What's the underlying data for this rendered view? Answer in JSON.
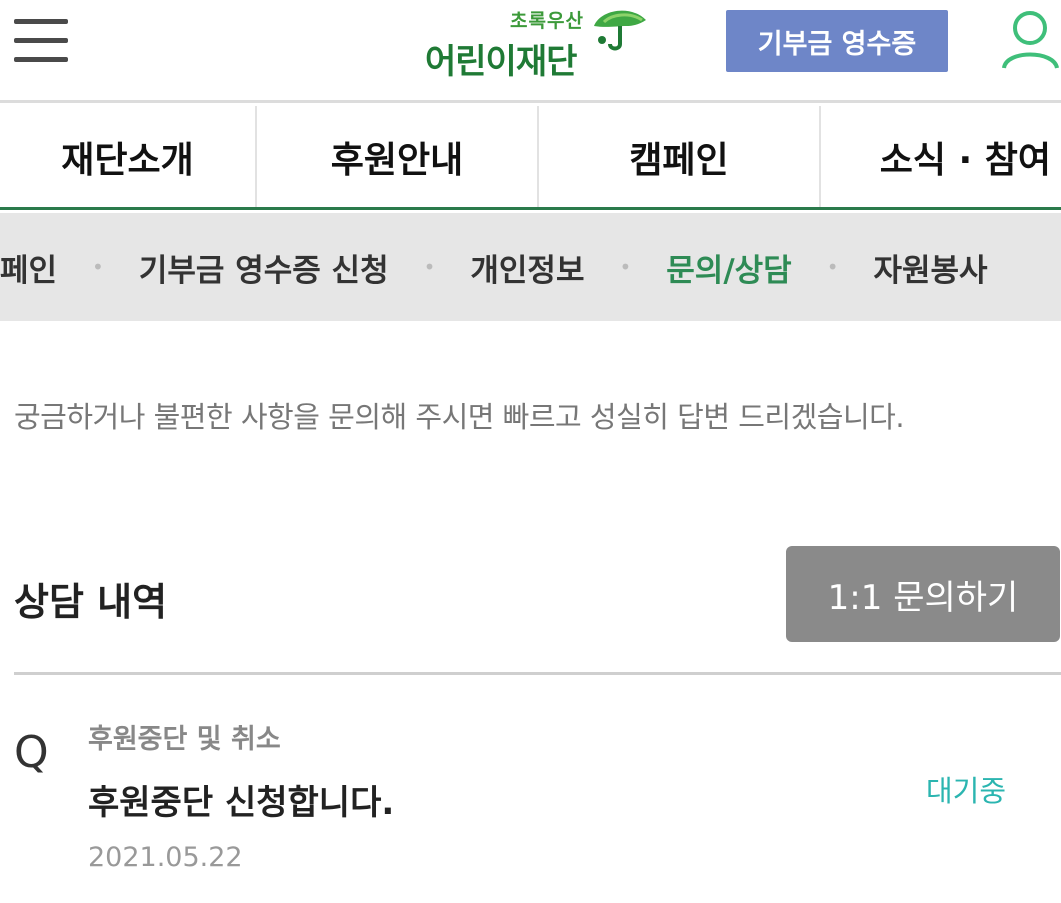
{
  "header": {
    "menu_icon": "hamburger-icon",
    "logo_tagline": "초록우산",
    "logo_name": "어린이재단",
    "logo_icon": "green-umbrella-icon",
    "receipt_button": "기부금 영수증",
    "user_icon": "user-icon"
  },
  "main_nav": [
    "재단소개",
    "후원안내",
    "캠페인",
    "소식 · 참여"
  ],
  "sub_nav": {
    "items": [
      "페인",
      "기부금 영수증 신청",
      "개인정보",
      "문의/상담",
      "자원봉사"
    ],
    "active": "문의/상담"
  },
  "description": "궁금하거나 불편한 사항을 문의해 주시면 빠르고 성실히 답변 드리겠습니다.",
  "history": {
    "title": "상담 내역",
    "inquiry_button": "1:1 문의하기",
    "items": [
      {
        "mark": "Q",
        "category": "후원중단 및 취소",
        "subject": "후원중단 신청합니다.",
        "status": "대기중",
        "date": "2021.05.22"
      }
    ]
  },
  "colors": {
    "brand_green": "#1f7a35",
    "receipt_button": "#6e86c8",
    "active_tab": "#2e8b55",
    "status": "#2bb5b0",
    "inquiry_button": "#8a8a8a"
  }
}
